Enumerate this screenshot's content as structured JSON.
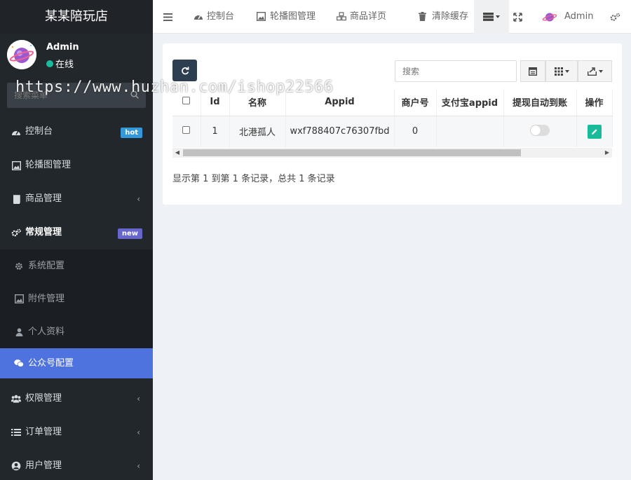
{
  "brand": {
    "title": "某某陪玩店"
  },
  "user": {
    "name": "Admin",
    "status": "在线"
  },
  "sidebar": {
    "search_placeholder": "搜索菜单",
    "items": [
      {
        "label": "控制台",
        "icon": "dashboard-icon",
        "badge": "hot"
      },
      {
        "label": "轮播图管理",
        "icon": "image-icon"
      },
      {
        "label": "商品管理",
        "icon": "book-icon",
        "chevron": "‹"
      },
      {
        "label": "常规管理",
        "icon": "cogs-icon",
        "badge": "new"
      }
    ],
    "submenu": [
      {
        "label": "系统配置",
        "icon": "gear-icon"
      },
      {
        "label": "附件管理",
        "icon": "file-image-icon"
      },
      {
        "label": "个人资料",
        "icon": "user-icon"
      },
      {
        "label": "公众号配置",
        "icon": "wechat-icon",
        "active": true
      }
    ],
    "items_after": [
      {
        "label": "权限管理",
        "icon": "group-icon",
        "chevron": "‹"
      },
      {
        "label": "订单管理",
        "icon": "list-icon",
        "chevron": "‹"
      },
      {
        "label": "用户管理",
        "icon": "user-circle-icon",
        "chevron": "‹"
      }
    ]
  },
  "topbar": {
    "tabs": [
      {
        "label": "控制台",
        "icon": "dashboard-icon"
      },
      {
        "label": "轮播图管理",
        "icon": "image-icon"
      },
      {
        "label": "商品详页",
        "icon": "cubes-icon"
      },
      {
        "label": "清除缓存",
        "icon": "trash-icon"
      }
    ],
    "admin_label": "Admin"
  },
  "toolbar": {
    "search_placeholder": "搜索"
  },
  "table": {
    "columns": [
      "Id",
      "名称",
      "Appid",
      "商户号",
      "支付宝appid",
      "提现自动到账",
      "操作"
    ],
    "rows": [
      {
        "id": "1",
        "name": "北港孤人",
        "appid": "wxf788407c76307fbd",
        "mch_id": "0",
        "alipay_appid": "",
        "auto_withdraw": false
      }
    ]
  },
  "pagination": {
    "info": "显示第 1 到第 1 条记录，总共 1 条记录"
  },
  "watermark": {
    "text": "https://www.huzhan.com/ishop22566"
  },
  "colors": {
    "sidebar_bg": "#22272c",
    "active": "#4e73df",
    "hot": "#3498db",
    "new": "#6666cc",
    "primary_btn": "#2c3e50",
    "success": "#18bc9c"
  }
}
